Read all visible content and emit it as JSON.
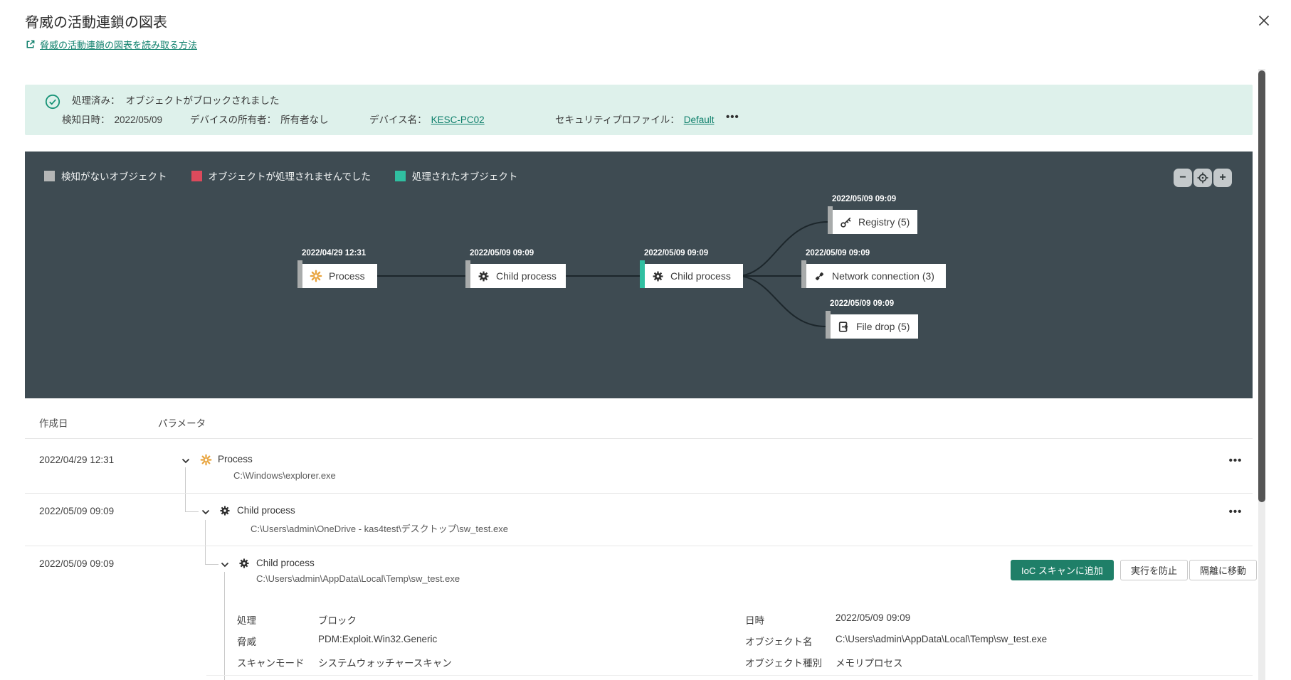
{
  "window": {
    "title": "脅威の活動連鎖の図表"
  },
  "help": {
    "link_label": "脅威の活動連鎖の図表を読み取る方法",
    "icon": "external-link-icon"
  },
  "banner": {
    "bg_color": "#def1eb",
    "icon": "check-circle-icon",
    "status_label": "処理済み：",
    "status_value": "オブジェクトがブロックされました",
    "fields": [
      {
        "label": "検知日時：",
        "value": "2022/05/09",
        "is_link": false
      },
      {
        "label": "デバイスの所有者：",
        "value": "所有者なし",
        "is_link": false
      },
      {
        "label": "デバイス名：",
        "value": "KESC-PC02",
        "is_link": true
      },
      {
        "label": "セキュリティプロファイル：",
        "value": "Default",
        "is_link": true
      }
    ],
    "more_label": "•••"
  },
  "graph": {
    "bg_color": "#3e4b52",
    "legend": [
      {
        "label": "検知がないオブジェクト",
        "color": "#b4b6b6"
      },
      {
        "label": "オブジェクトが処理されませんでした",
        "color": "#dc4a5c"
      },
      {
        "label": "処理されたオブジェクト",
        "color": "#30bfa1"
      }
    ],
    "zoom_controls": {
      "minus": "−",
      "plus": "+",
      "center_icon": "crosshair-icon"
    },
    "nodes": [
      {
        "timestamp": "2022/04/29 12:31",
        "label": "Process",
        "icon": "process-burst-icon",
        "status_color": "#a8abab"
      },
      {
        "timestamp": "2022/05/09 09:09",
        "label": "Child process",
        "icon": "gear-icon",
        "status_color": "#a8abab"
      },
      {
        "timestamp": "2022/05/09 09:09",
        "label": "Child process",
        "icon": "gear-icon",
        "status_color": "#30bfa1"
      },
      {
        "timestamp": "2022/05/09 09:09",
        "label": "Registry (5)",
        "icon": "key-icon",
        "status_color": "#a8abab"
      },
      {
        "timestamp": "2022/05/09 09:09",
        "label": "Network connection (3)",
        "icon": "network-icon",
        "status_color": "#a8abab"
      },
      {
        "timestamp": "2022/05/09 09:09",
        "label": "File drop (5)",
        "icon": "file-drop-icon",
        "status_color": "#a8abab"
      }
    ]
  },
  "table": {
    "columns": [
      "作成日",
      "パラメータ"
    ],
    "rows": [
      {
        "date": "2022/04/29 12:31",
        "name": "Process",
        "path": "C:\\Windows\\explorer.exe",
        "icon": "process-burst-icon",
        "menu_label": "•••"
      },
      {
        "date": "2022/05/09 09:09",
        "name": "Child process",
        "path": "C:\\Users\\admin\\OneDrive - kas4test\\デスクトップ\\sw_test.exe",
        "icon": "gear-icon",
        "menu_label": "•••"
      },
      {
        "date": "2022/05/09 09:09",
        "name": "Child process",
        "path": "C:\\Users\\admin\\AppData\\Local\\Temp\\sw_test.exe",
        "icon": "gear-icon"
      }
    ],
    "actions": [
      {
        "label": "IoC スキャンに追加",
        "style": "primary"
      },
      {
        "label": "実行を防止",
        "style": "secondary"
      },
      {
        "label": "隔離に移動",
        "style": "secondary"
      }
    ],
    "details": {
      "left": [
        {
          "label": "処理",
          "value": "ブロック"
        },
        {
          "label": "脅威",
          "value": "PDM:Exploit.Win32.Generic"
        },
        {
          "label": "スキャンモード",
          "value": "システムウォッチャースキャン"
        }
      ],
      "right": [
        {
          "label": "日時",
          "value": "2022/05/09 09:09"
        },
        {
          "label": "オブジェクト名",
          "value": "C:\\Users\\admin\\AppData\\Local\\Temp\\sw_test.exe"
        },
        {
          "label": "オブジェクト種別",
          "value": "メモリプロセス"
        }
      ]
    }
  },
  "colors": {
    "accent_teal": "#0f806c",
    "primary_button": "#1f7f68",
    "panel_dark": "#3e4b52",
    "legend_gray": "#b4b6b6",
    "legend_red": "#dc4a5c",
    "legend_teal": "#30bfa1"
  }
}
